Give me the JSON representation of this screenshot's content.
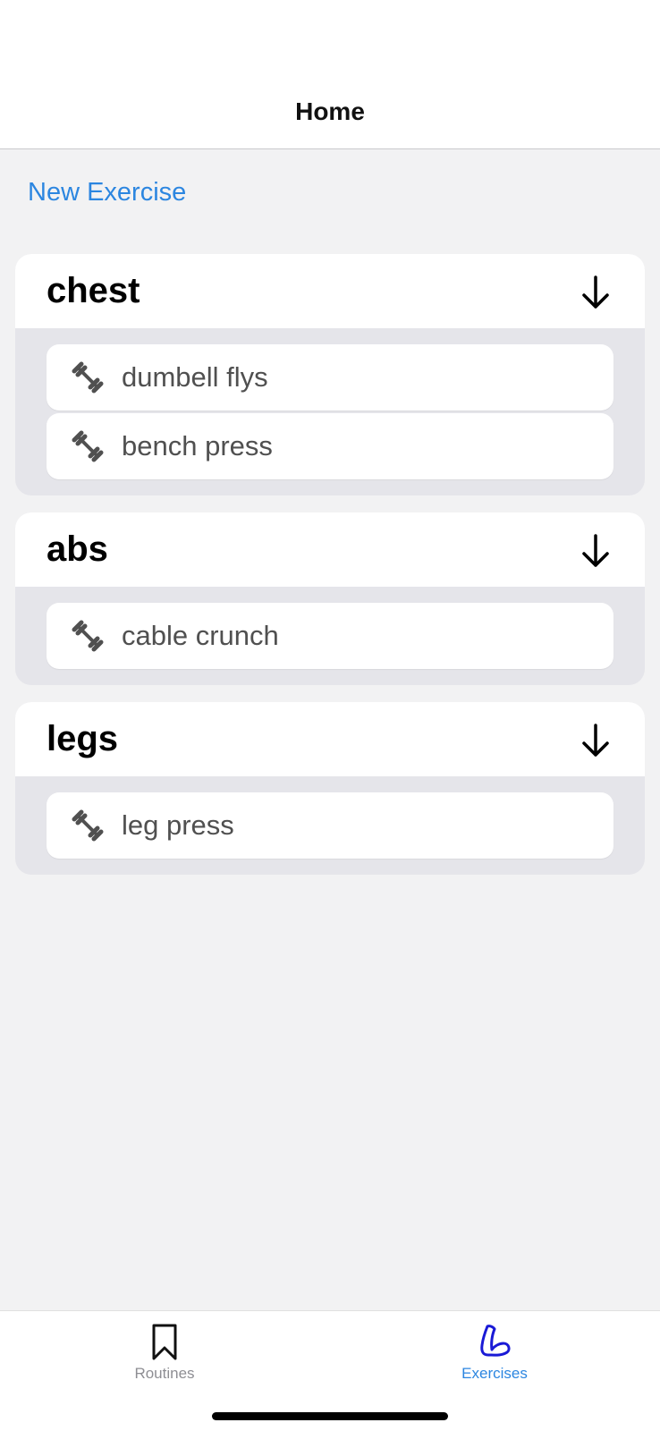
{
  "nav": {
    "title": "Home"
  },
  "actions": {
    "new_exercise": "New Exercise"
  },
  "groups": [
    {
      "title": "chest",
      "items": [
        "dumbell flys",
        "bench press"
      ]
    },
    {
      "title": "abs",
      "items": [
        "cable crunch"
      ]
    },
    {
      "title": "legs",
      "items": [
        "leg press"
      ]
    }
  ],
  "tabs": [
    {
      "label": "Routines",
      "icon": "bookmark-icon",
      "active": false
    },
    {
      "label": "Exercises",
      "icon": "bicep-icon",
      "active": true
    }
  ],
  "colors": {
    "accent": "#2c86e0",
    "tab_active": "#2c86e0",
    "tab_inactive": "#8e8e93"
  }
}
